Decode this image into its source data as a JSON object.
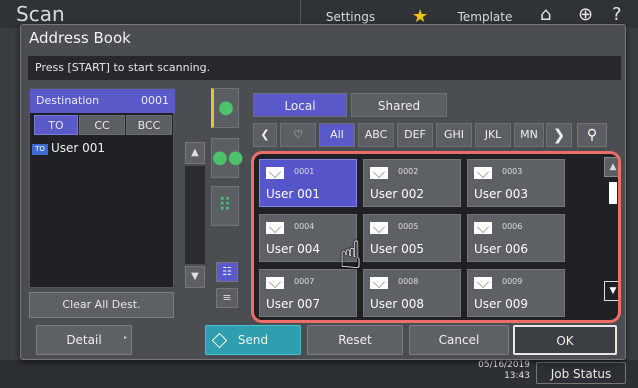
{
  "header": {
    "app_title": "Scan",
    "settings_label": "Settings",
    "template_label": "Template",
    "home_icon": "home-icon",
    "globe_icon": "globe-icon",
    "help_icon": "help-icon"
  },
  "footer": {
    "date": "05/16/2019",
    "time": "13:43",
    "job_status_label": "Job Status"
  },
  "dialog": {
    "title": "Address Book",
    "message": "Press [START] to start scanning."
  },
  "destination": {
    "label": "Destination",
    "count": "0001",
    "segments": [
      "TO",
      "CC",
      "BCC"
    ],
    "entries": [
      {
        "badge": "TO",
        "name": "User 001"
      }
    ],
    "clear_label": "Clear All Dest."
  },
  "tabs": {
    "local": "Local",
    "shared": "Shared"
  },
  "index_tabs": [
    "All",
    "ABC",
    "DEF",
    "GHI",
    "JKL",
    "MN"
  ],
  "users": [
    {
      "num": "0001",
      "name": "User 001",
      "selected": true
    },
    {
      "num": "0002",
      "name": "User 002",
      "selected": false
    },
    {
      "num": "0003",
      "name": "User 003",
      "selected": false
    },
    {
      "num": "0004",
      "name": "User 004",
      "selected": false
    },
    {
      "num": "0005",
      "name": "User 005",
      "selected": false
    },
    {
      "num": "0006",
      "name": "User 006",
      "selected": false
    },
    {
      "num": "0007",
      "name": "User 007",
      "selected": false
    },
    {
      "num": "0008",
      "name": "User 008",
      "selected": false
    },
    {
      "num": "0009",
      "name": "User 009",
      "selected": false
    }
  ],
  "buttons": {
    "detail": "Detail",
    "send": "Send",
    "reset": "Reset",
    "cancel": "Cancel",
    "ok": "OK"
  },
  "colors": {
    "accent": "#5a59c9",
    "send": "#2f9fb0",
    "highlight": "#ec6e66",
    "icon_green": "#4cc36b"
  }
}
